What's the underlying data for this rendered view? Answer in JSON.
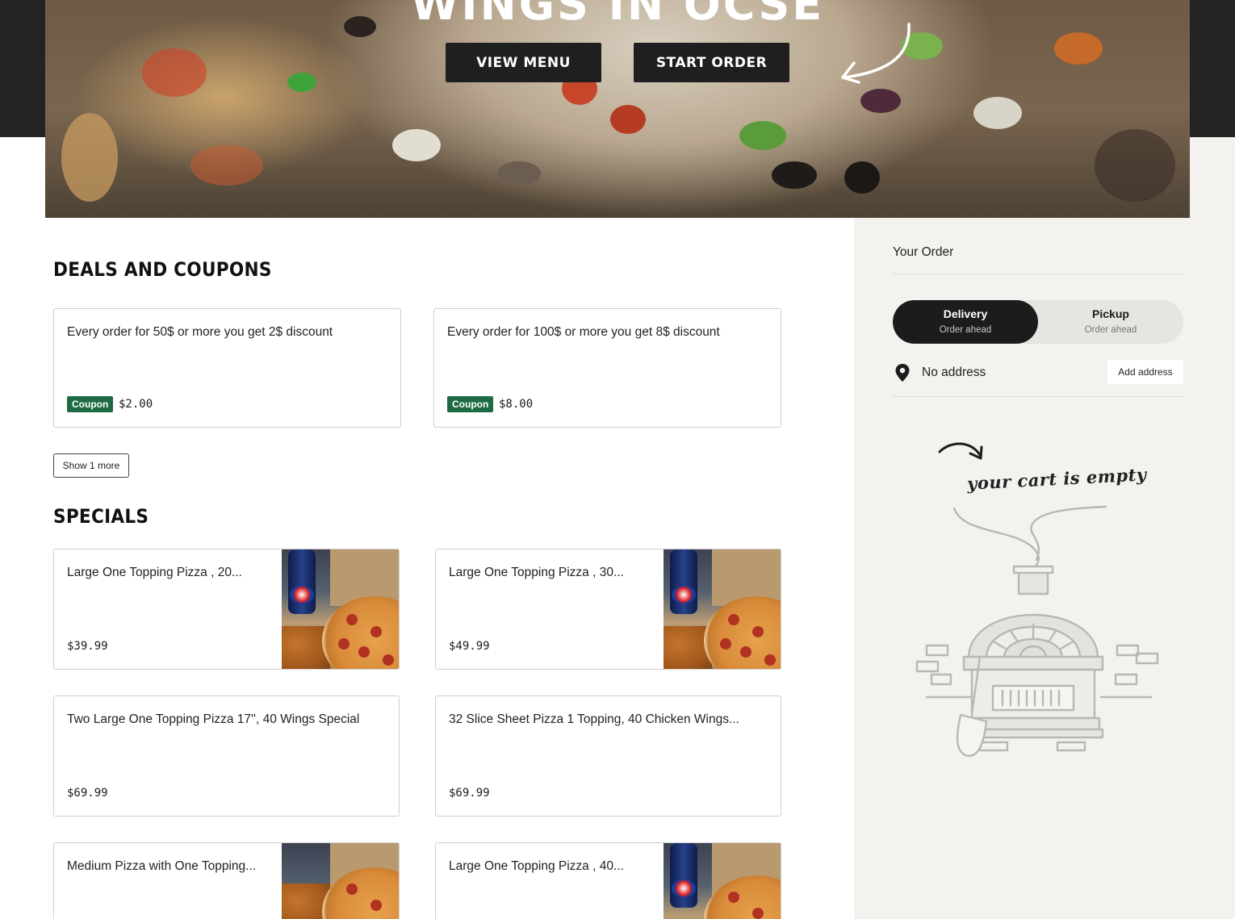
{
  "hero": {
    "title": "WINGS IN OCSE",
    "buttons": {
      "view_menu": "VIEW MENU",
      "start_order": "START ORDER"
    }
  },
  "deals": {
    "heading": "DEALS AND COUPONS",
    "coupons": [
      {
        "text": "Every order for 50$ or more you get 2$ discount",
        "badge": "Coupon",
        "amount": "$2.00"
      },
      {
        "text": "Every order for 100$ or more you get 8$ discount",
        "badge": "Coupon",
        "amount": "$8.00"
      }
    ],
    "show_more": "Show 1 more"
  },
  "specials": {
    "heading": "SPECIALS",
    "items": [
      {
        "name": "Large One Topping Pizza , 20...",
        "price": "$39.99",
        "has_image": true
      },
      {
        "name": "Large One Topping Pizza , 30...",
        "price": "$49.99",
        "has_image": true
      },
      {
        "name": "Two Large One Topping Pizza 17'', 40 Wings Special",
        "price": "$69.99",
        "has_image": false
      },
      {
        "name": "32 Slice Sheet Pizza 1 Topping, 40 Chicken Wings...",
        "price": "$69.99",
        "has_image": false
      },
      {
        "name": "Medium Pizza with One Topping...",
        "price": "",
        "has_image": true
      },
      {
        "name": "Large One Topping Pizza , 40...",
        "price": "",
        "has_image": true
      }
    ]
  },
  "order": {
    "title": "Your Order",
    "modes": [
      {
        "label": "Delivery",
        "sub": "Order ahead",
        "active": true
      },
      {
        "label": "Pickup",
        "sub": "Order ahead",
        "active": false
      }
    ],
    "address": "No address",
    "add_address": "Add address",
    "empty_cart": "your cart is empty"
  },
  "colors": {
    "coupon_badge": "#1e6b43",
    "dark": "#1c1c1c",
    "sidebar_bg": "#f3f2ee"
  },
  "icons": [
    "arrow-curve-icon",
    "map-pin-icon",
    "curvy-arrow-icon",
    "pizza-oven-illustration"
  ]
}
